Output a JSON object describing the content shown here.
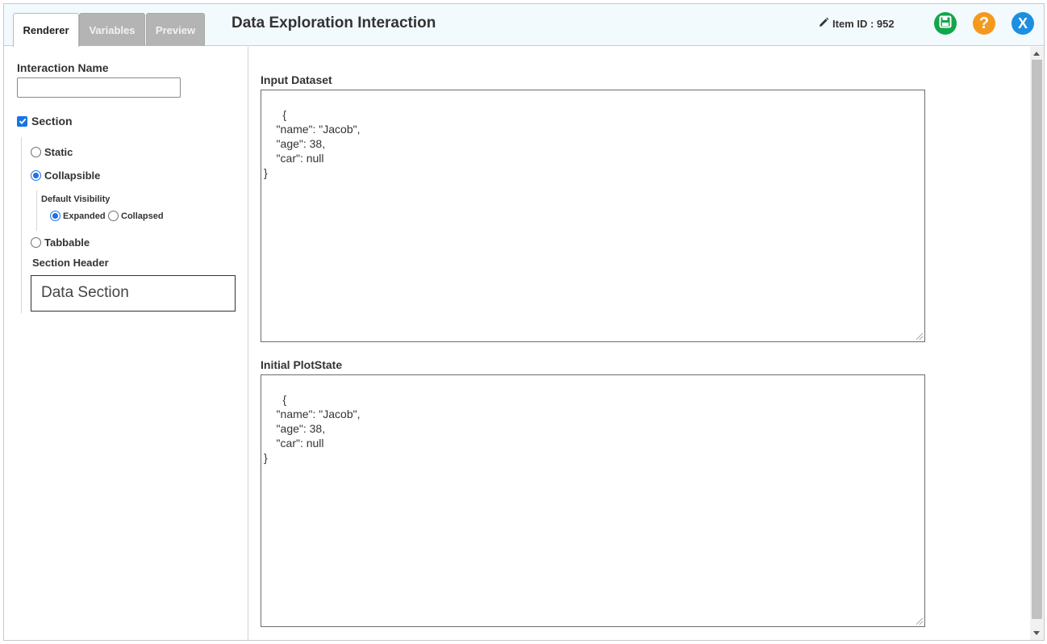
{
  "header": {
    "tabs": [
      {
        "label": "Renderer",
        "active": true
      },
      {
        "label": "Variables",
        "active": false
      },
      {
        "label": "Preview",
        "active": false
      }
    ],
    "title": "Data Exploration Interaction",
    "item_id_label": "Item ID : 952",
    "icons": {
      "edit": "pencil-icon",
      "save": "save-icon",
      "help": "help-icon",
      "close": "close-icon"
    },
    "help_glyph": "?",
    "close_glyph": "X",
    "colors": {
      "save": "#12a64a",
      "help": "#f39a1e",
      "close": "#1c8fe0",
      "header_bg": "#f3fafd",
      "accent": "#1a73e8"
    }
  },
  "left": {
    "interaction_name_label": "Interaction Name",
    "interaction_name_value": "",
    "section_label": "Section",
    "section_checked": true,
    "options": {
      "static": "Static",
      "collapsible": "Collapsible",
      "tabbable": "Tabbable"
    },
    "selected_option": "Collapsible",
    "default_visibility_label": "Default Visibility",
    "visibility": {
      "expanded": "Expanded",
      "collapsed": "Collapsed"
    },
    "selected_visibility": "Expanded",
    "section_header_label": "Section Header",
    "section_header_value": "Data Section"
  },
  "main": {
    "input_dataset_label": "Input Dataset",
    "input_dataset_value": "{\n    \"name\": \"Jacob\",\n    \"age\": 38,\n    \"car\": null\n}",
    "initial_plotstate_label": "Initial PlotState",
    "initial_plotstate_value": "{\n    \"name\": \"Jacob\",\n    \"age\": 38,\n    \"car\": null\n}"
  }
}
